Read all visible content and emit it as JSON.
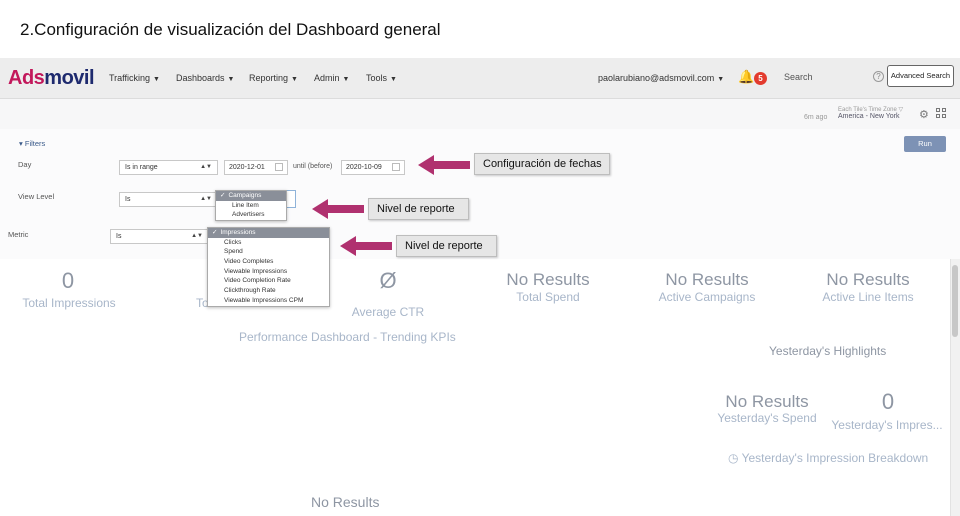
{
  "document_title": "2.Configuración de visualización del Dashboard general",
  "nav": {
    "logo_first": "Ads",
    "logo_rest": "movil",
    "items": [
      "Trafficking",
      "Dashboards",
      "Reporting",
      "Admin",
      "Tools"
    ],
    "user": "paolarubiano@adsmovil.com",
    "notifications": "5",
    "search_label": "Search",
    "advanced_search": "Advanced Search",
    "brand_color": "#c2185b"
  },
  "timezone": {
    "ago": "6m ago",
    "label": "Each Tile's Time Zone",
    "value": "America - New York"
  },
  "filters": {
    "toggle": "Filters",
    "run": "Run",
    "day": {
      "label": "Day",
      "operator": "Is in range",
      "from": "2020-12-01",
      "until_label": "until (before)",
      "to": "2020-10-09"
    },
    "view_level": {
      "label": "View Level",
      "operator": "Is",
      "options": [
        "Campaigns",
        "Line Item",
        "Advertisers"
      ],
      "selected": "Campaigns"
    },
    "metric": {
      "label": "Metric",
      "operator": "Is",
      "options": [
        "Impressions",
        "Clicks",
        "Spend",
        "Video Completes",
        "Viewable Impressions",
        "Video Completion Rate",
        "Clickthrough Rate",
        "Viewable Impressions CPM"
      ],
      "selected": "Impressions"
    }
  },
  "callouts": {
    "dates": "Configuración de fechas",
    "level1": "Nivel de reporte",
    "level2": "Nivel de reporte",
    "arrow_color": "#b0316f"
  },
  "dashboard": {
    "kpis": [
      {
        "value": "0",
        "label": "Total Impressions"
      },
      {
        "value": "",
        "label": "To"
      },
      {
        "value": "Ø",
        "label": "Average CTR"
      },
      {
        "value": "No Results",
        "label": "Total Spend"
      },
      {
        "value": "No Results",
        "label": "Active Campaigns"
      },
      {
        "value": "No Results",
        "label": "Active Line Items"
      }
    ],
    "trending_title": "Performance Dashboard - Trending KPIs",
    "highlights_title": "Yesterday's Highlights",
    "yesterday_spend": {
      "value": "No Results",
      "label": "Yesterday's Spend"
    },
    "yesterday_impressions": {
      "value": "0",
      "label": "Yesterday's Impres..."
    },
    "breakdown_title": "Yesterday's Impression Breakdown",
    "bottom_result": "No Results"
  }
}
